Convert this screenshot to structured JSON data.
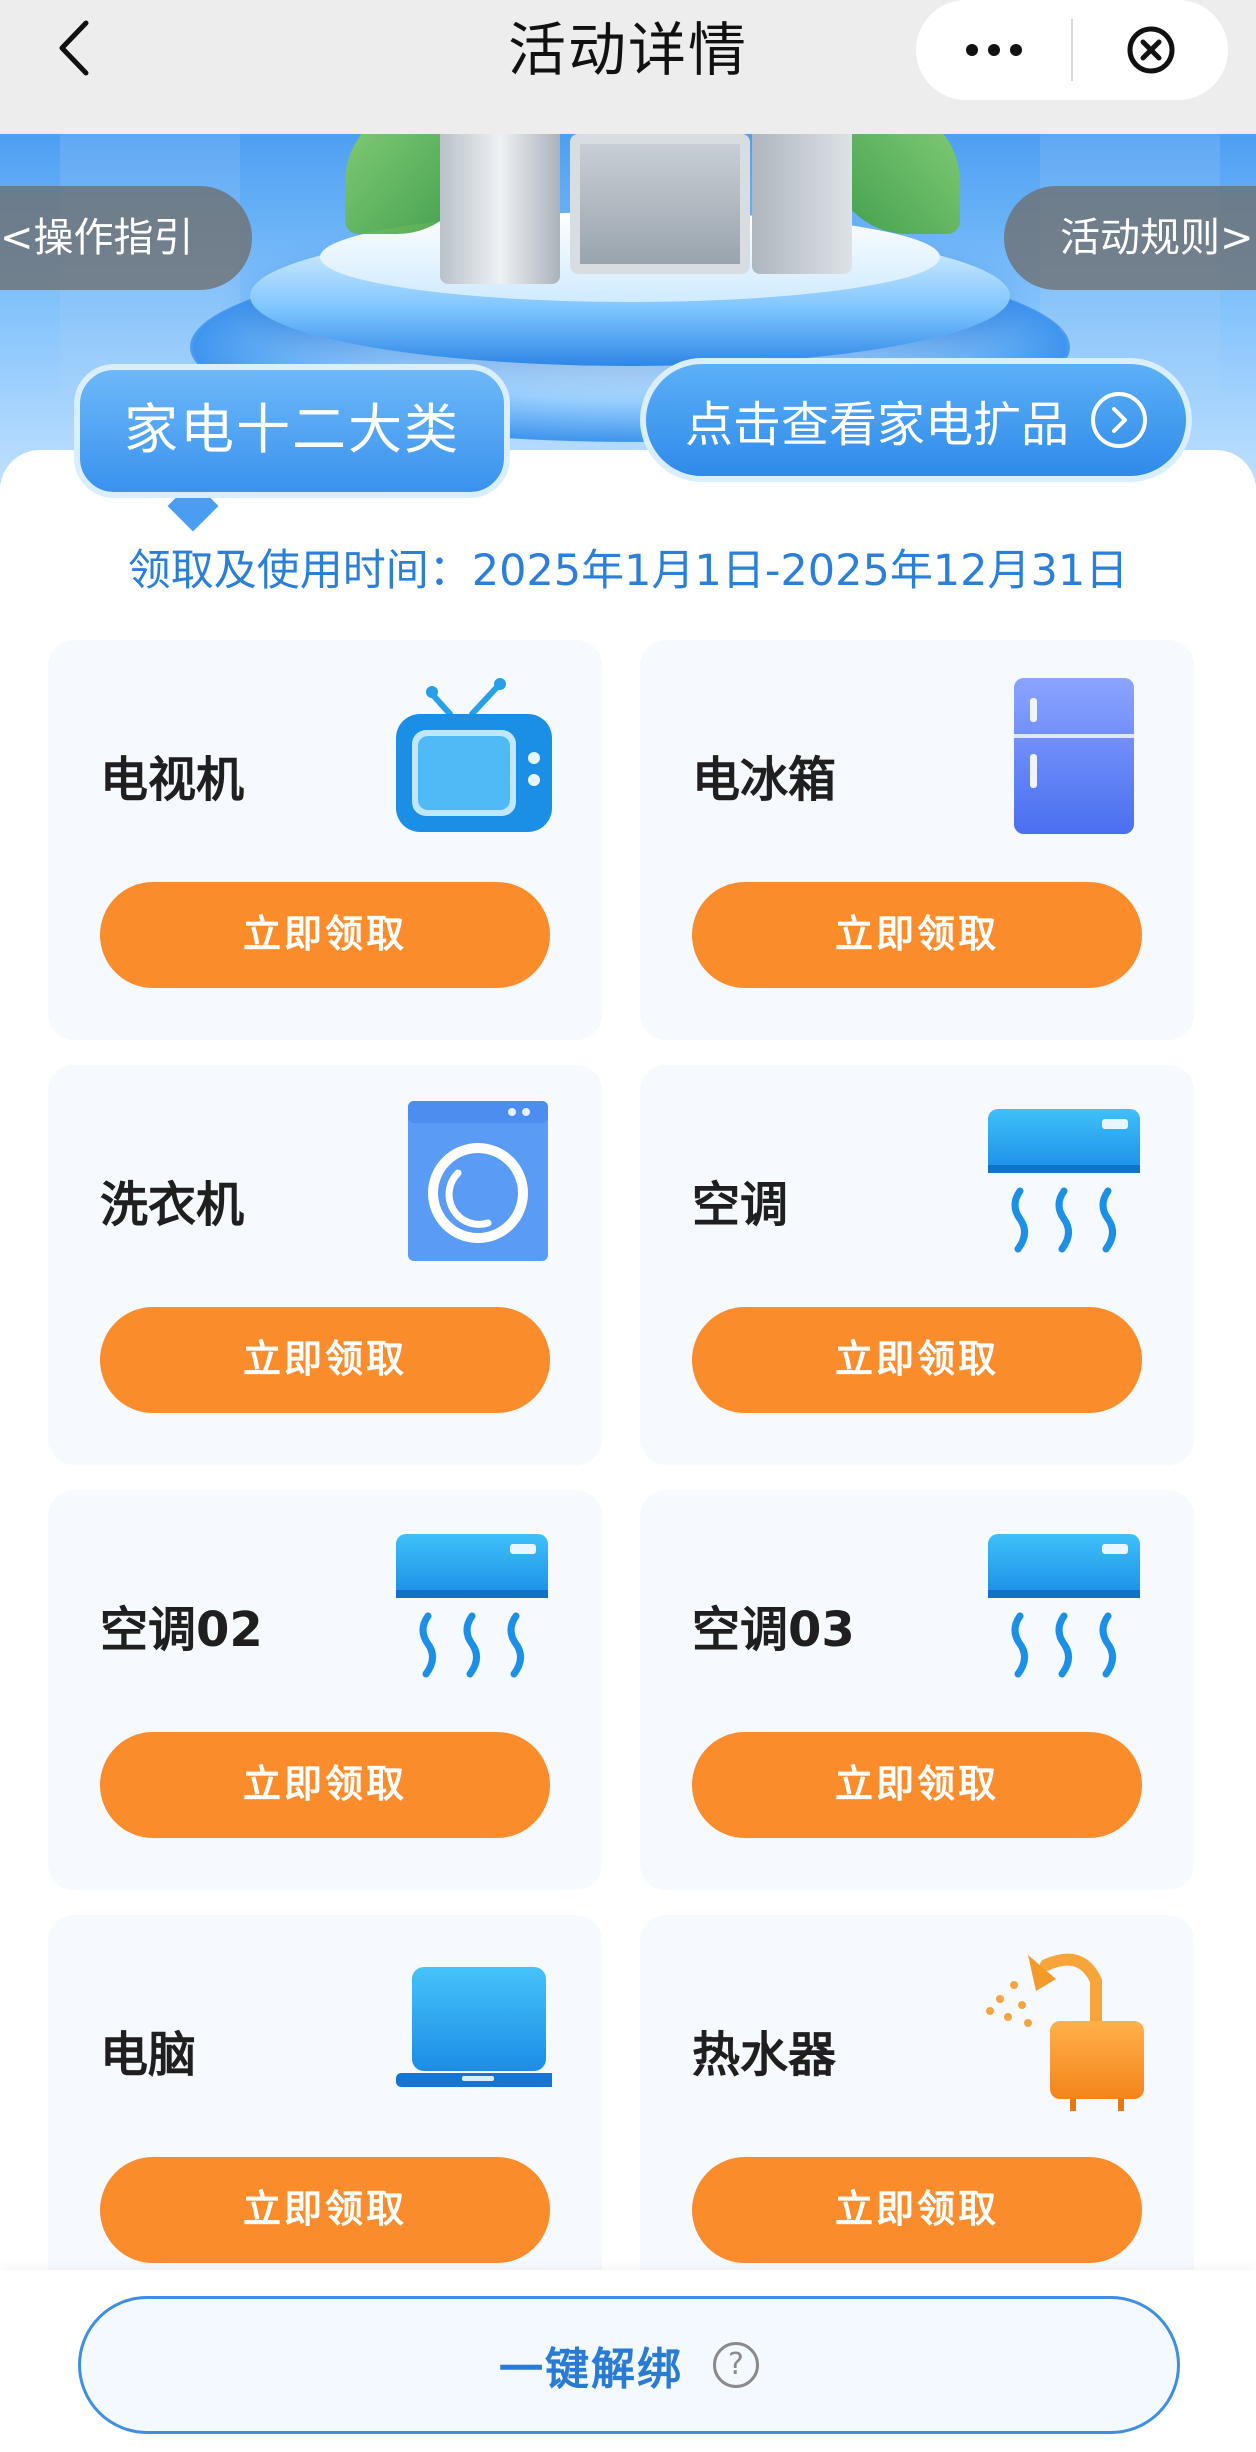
{
  "navbar": {
    "title": "活动详情",
    "back_icon": "chevron-left-icon",
    "more_icon": "more-dots-icon",
    "close_icon": "close-circle-icon"
  },
  "banner": {
    "guide_label": "<操作指引",
    "rules_label": "活动规则>"
  },
  "category": {
    "tag_label": "家电十二大类",
    "expand_label": "点击查看家电扩品",
    "period_text": "领取及使用时间：2025年1月1日-2025年12月31日"
  },
  "items": [
    {
      "name": "电视机",
      "icon": "tv-icon",
      "button": "立即领取"
    },
    {
      "name": "电冰箱",
      "icon": "fridge-icon",
      "button": "立即领取"
    },
    {
      "name": "洗衣机",
      "icon": "washing-machine-icon",
      "button": "立即领取"
    },
    {
      "name": "空调",
      "icon": "air-conditioner-icon",
      "button": "立即领取"
    },
    {
      "name": "空调02",
      "icon": "air-conditioner-icon",
      "button": "立即领取"
    },
    {
      "name": "空调03",
      "icon": "air-conditioner-icon",
      "button": "立即领取"
    },
    {
      "name": "电脑",
      "icon": "laptop-icon",
      "button": "立即领取"
    },
    {
      "name": "热水器",
      "icon": "water-heater-icon",
      "button": "立即领取"
    }
  ],
  "bottom": {
    "unbind_label": "一键解绑",
    "help_icon": "question-circle-icon"
  },
  "colors": {
    "accent_blue": "#2b7fd8",
    "claim_orange": "#fb8c2c"
  }
}
